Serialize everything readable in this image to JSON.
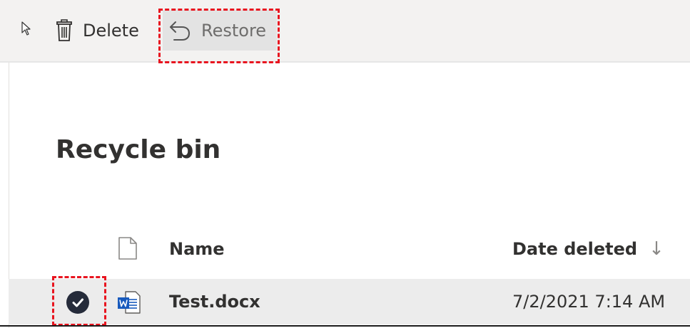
{
  "toolbar": {
    "delete_label": "Delete",
    "restore_label": "Restore"
  },
  "page": {
    "title": "Recycle bin"
  },
  "table": {
    "columns": {
      "name": "Name",
      "date_deleted": "Date deleted",
      "sort_indicator": "↓"
    },
    "rows": [
      {
        "name": "Test.docx",
        "date_deleted": "7/2/2021 7:14 AM",
        "selected": true,
        "file_icon": "word-doc-icon"
      }
    ]
  },
  "colors": {
    "toolbar_bg": "#f3f2f1",
    "selected_row_bg": "#ececec",
    "highlight_box": "#e8141f",
    "word_blue": "#185abd",
    "check_circle": "#252b3a"
  },
  "icons": {
    "cursor": "pointer-cursor-icon",
    "delete": "trash-icon",
    "restore": "undo-arrow-icon",
    "file_header": "file-icon",
    "row_check": "checkmark-icon",
    "row_file": "word-doc-icon"
  }
}
